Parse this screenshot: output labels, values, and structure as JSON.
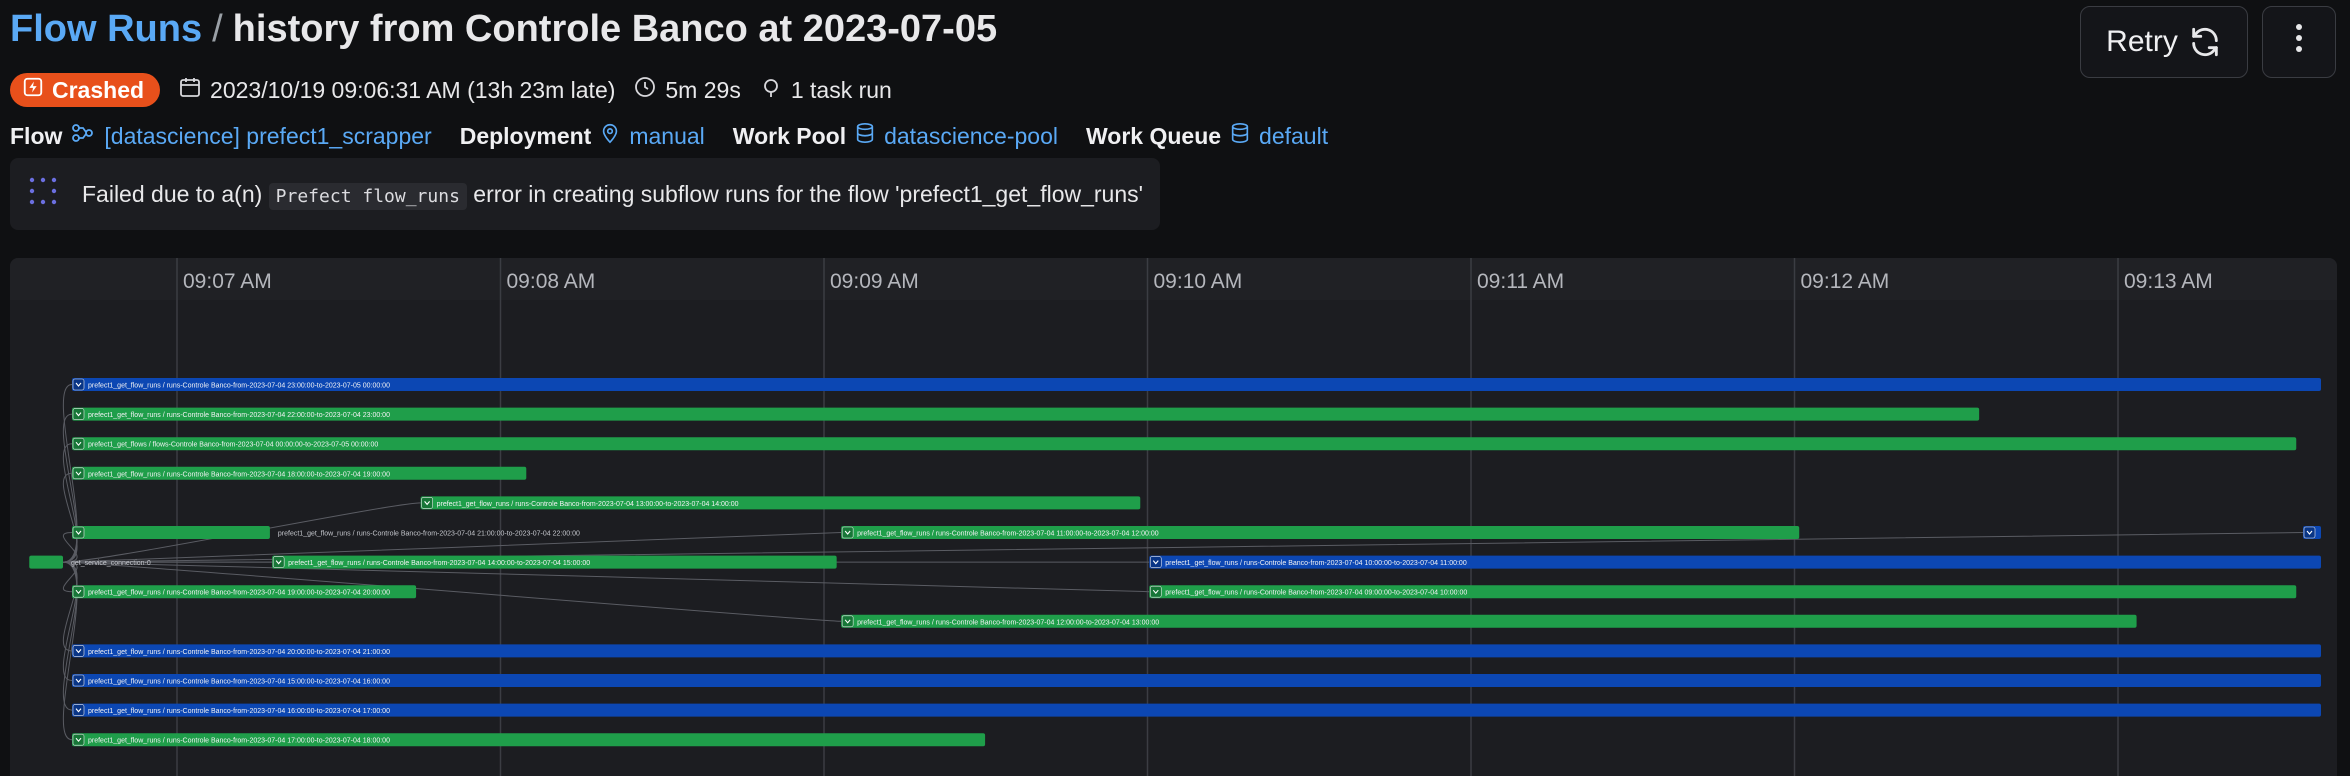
{
  "header": {
    "breadcrumb_root": "Flow Runs",
    "separator": "/",
    "run_name": "history from Controle Banco at 2023-07-05"
  },
  "actions": {
    "retry_label": "Retry"
  },
  "status": {
    "state": "Crashed",
    "state_color": "#e8501b",
    "start_time": "2023/10/19 09:06:31 AM (13h 23m late)",
    "duration": "5m 29s",
    "task_runs": "1 task run"
  },
  "details": {
    "flow_label": "Flow",
    "flow_value": "[datascience] prefect1_scrapper",
    "deployment_label": "Deployment",
    "deployment_value": "manual",
    "work_pool_label": "Work Pool",
    "work_pool_value": "datascience-pool",
    "work_queue_label": "Work Queue",
    "work_queue_value": "default"
  },
  "message": {
    "before": "Failed due to a(n)",
    "code": "Prefect flow_runs",
    "after": "error in creating subflow runs for the flow 'prefect1_get_flow_runs'"
  },
  "timeline": {
    "ticks": [
      "09:07 AM",
      "09:08 AM",
      "09:09 AM",
      "09:10 AM",
      "09:11 AM",
      "09:12 AM",
      "09:13 AM"
    ],
    "colors": {
      "completed": "#1f9e4a",
      "running": "#0c47b3"
    },
    "bars": [
      {
        "label": "prefect1_get_flow_runs / runs-Controle Banco-from-2023-07-04 23:00:00-to-2023-07-05 00:00:00",
        "state": "running",
        "start": 0.0,
        "end": 1.0,
        "row": 0,
        "label_outside": false
      },
      {
        "label": "prefect1_get_flow_runs / runs-Controle Banco-from-2023-07-04 22:00:00-to-2023-07-04 23:00:00",
        "state": "completed",
        "start": 0.0,
        "end": 0.848,
        "row": 1,
        "label_outside": false
      },
      {
        "label": "prefect1_get_flows / flows-Controle Banco-from-2023-07-04 00:00:00-to-2023-07-05 00:00:00",
        "state": "completed",
        "start": 0.0,
        "end": 0.989,
        "row": 2,
        "label_outside": false
      },
      {
        "label": "prefect1_get_flow_runs / runs-Controle Banco-from-2023-07-04 18:00:00-to-2023-07-04 19:00:00",
        "state": "completed",
        "start": 0.0,
        "end": 0.202,
        "row": 3,
        "label_outside": false
      },
      {
        "label": "prefect1_get_flow_runs / runs-Controle Banco-from-2023-07-04 13:00:00-to-2023-07-04 14:00:00",
        "state": "completed",
        "start": 0.155,
        "end": 0.475,
        "row": 4,
        "label_outside": false
      },
      {
        "label": "prefect1_get_flow_runs / runs-Controle Banco-from-2023-07-04 21:00:00-to-2023-07-04 22:00:00",
        "state": "completed",
        "start": 0.0,
        "end": 0.088,
        "row": 5,
        "label_outside": true
      },
      {
        "label": "prefect1_get_flow_runs / runs-Controle Banco-from-2023-07-04 11:00:00-to-2023-07-04 12:00:00",
        "state": "completed",
        "start": 0.342,
        "end": 0.768,
        "row": 5,
        "label_outside": false
      },
      {
        "label": "",
        "state": "running",
        "start": 0.992,
        "end": 1.0,
        "row": 5,
        "label_outside": false
      },
      {
        "label": "get_service_connection-0",
        "state": "completed",
        "start": -0.019,
        "end": -0.004,
        "row": 6,
        "label_outside": true
      },
      {
        "label": "prefect1_get_flow_runs / runs-Controle Banco-from-2023-07-04 14:00:00-to-2023-07-04 15:00:00",
        "state": "completed",
        "start": 0.089,
        "end": 0.34,
        "row": 6,
        "label_outside": false
      },
      {
        "label": "prefect1_get_flow_runs / runs-Controle Banco-from-2023-07-04 10:00:00-to-2023-07-04 11:00:00",
        "state": "running",
        "start": 0.479,
        "end": 1.0,
        "row": 6,
        "label_outside": false
      },
      {
        "label": "prefect1_get_flow_runs / runs-Controle Banco-from-2023-07-04 19:00:00-to-2023-07-04 20:00:00",
        "state": "completed",
        "start": 0.0,
        "end": 0.153,
        "row": 7,
        "label_outside": false
      },
      {
        "label": "prefect1_get_flow_runs / runs-Controle Banco-from-2023-07-04 09:00:00-to-2023-07-04 10:00:00",
        "state": "completed",
        "start": 0.479,
        "end": 0.989,
        "row": 7,
        "label_outside": false
      },
      {
        "label": "prefect1_get_flow_runs / runs-Controle Banco-from-2023-07-04 12:00:00-to-2023-07-04 13:00:00",
        "state": "completed",
        "start": 0.342,
        "end": 0.918,
        "row": 8,
        "label_outside": false
      },
      {
        "label": "prefect1_get_flow_runs / runs-Controle Banco-from-2023-07-04 20:00:00-to-2023-07-04 21:00:00",
        "state": "running",
        "start": 0.0,
        "end": 1.0,
        "row": 9,
        "label_outside": false
      },
      {
        "label": "prefect1_get_flow_runs / runs-Controle Banco-from-2023-07-04 15:00:00-to-2023-07-04 16:00:00",
        "state": "running",
        "start": 0.0,
        "end": 1.0,
        "row": 10,
        "label_outside": false
      },
      {
        "label": "prefect1_get_flow_runs / runs-Controle Banco-from-2023-07-04 16:00:00-to-2023-07-04 17:00:00",
        "state": "running",
        "start": 0.0,
        "end": 1.0,
        "row": 11,
        "label_outside": false
      },
      {
        "label": "prefect1_get_flow_runs / runs-Controle Banco-from-2023-07-04 17:00:00-to-2023-07-04 18:00:00",
        "state": "completed",
        "start": 0.0,
        "end": 0.406,
        "row": 12,
        "label_outside": false
      }
    ]
  }
}
